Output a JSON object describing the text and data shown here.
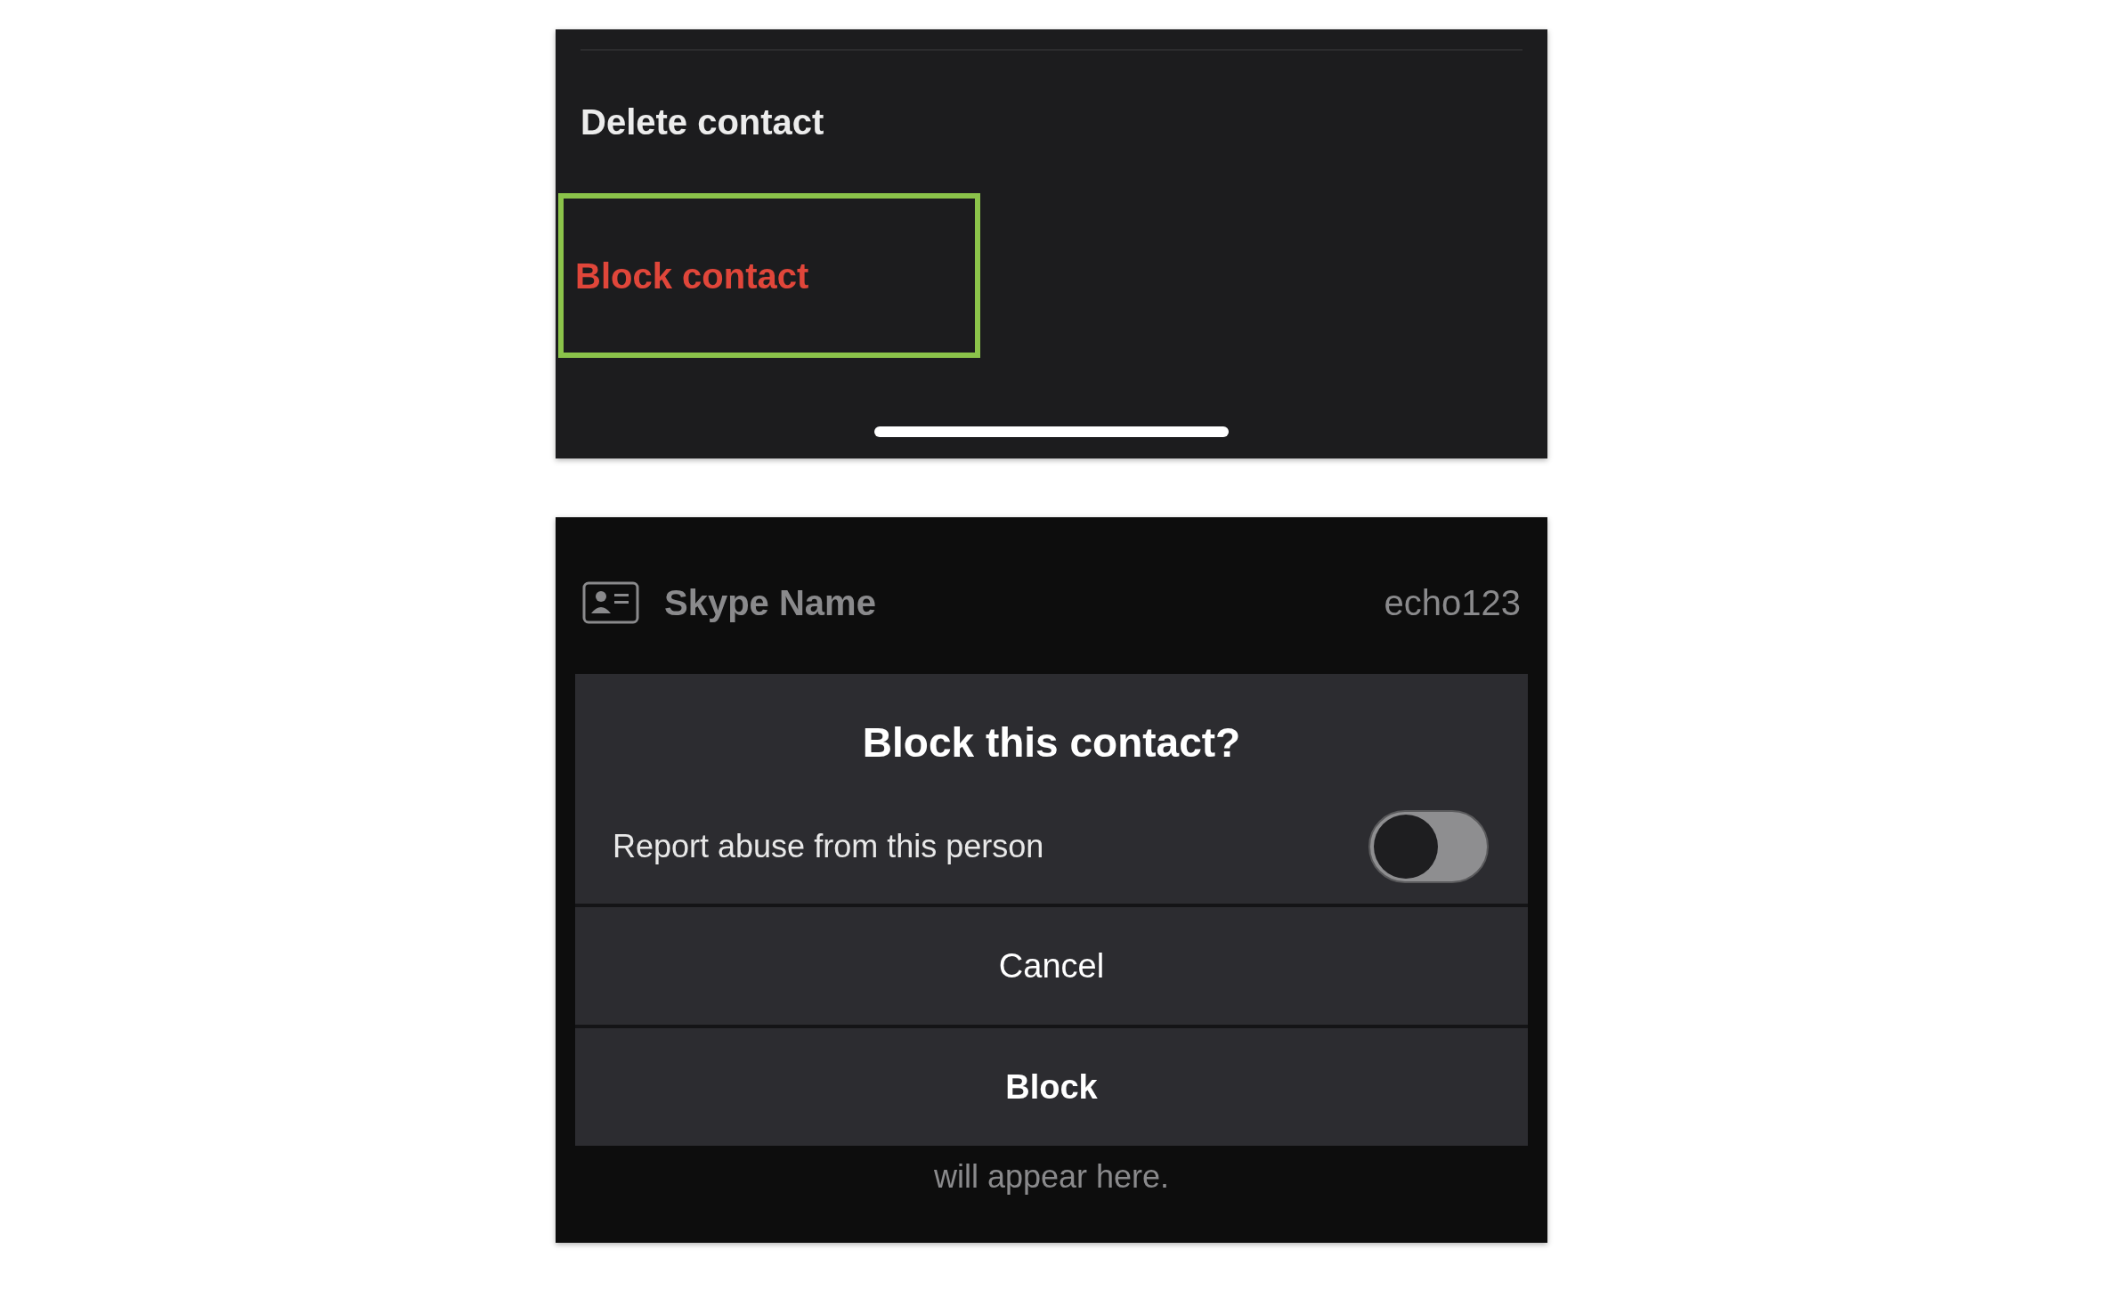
{
  "menu": {
    "items": [
      {
        "label": "Delete contact",
        "kind": "normal",
        "highlighted": false
      },
      {
        "label": "Block contact",
        "kind": "destructive",
        "highlighted": true
      }
    ]
  },
  "profile": {
    "field_label": "Skype Name",
    "field_value": "echo123"
  },
  "dialog": {
    "title": "Block this contact?",
    "option": {
      "label": "Report abuse from this person",
      "on": false
    },
    "buttons": [
      {
        "label": "Cancel",
        "kind": "secondary"
      },
      {
        "label": "Block",
        "kind": "primary"
      }
    ]
  },
  "footer_text": "will appear here."
}
